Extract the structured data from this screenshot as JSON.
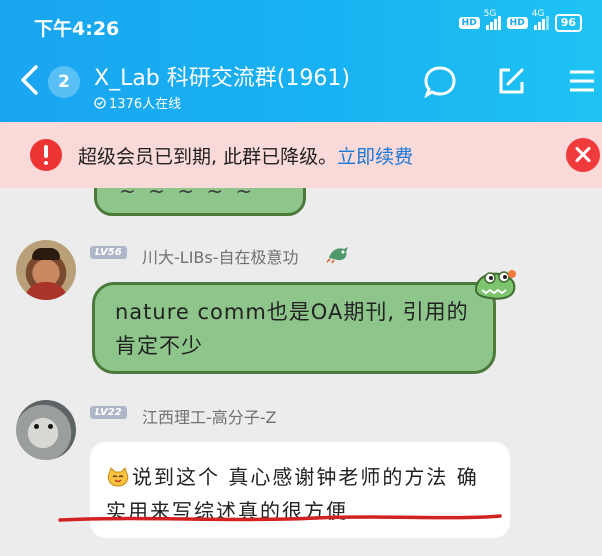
{
  "status_bar": {
    "time": "下午4:26",
    "hd1": "HD",
    "net1": "5G",
    "hd2": "HD",
    "net2": "4G",
    "battery": "96"
  },
  "header": {
    "unread_count": "2",
    "group_name": "X_Lab 科研交流群(1961)",
    "online_count": "1376人在线"
  },
  "banner": {
    "message": "超级会员已到期, 此群已降级。",
    "link": "立即续费"
  },
  "messages": [
    {
      "level": "LV56",
      "sender": "川大-LIBs-自在极意功",
      "text": "nature comm也是OA期刊, 引用的肯定不少"
    },
    {
      "level": "LV22",
      "sender": "江西理工-高分子-Z",
      "text": "说到这个 真心感谢钟老师的方法 确实用来写综述真的很方便"
    }
  ],
  "colors": {
    "header_start": "#1aa5f0",
    "header_end": "#1fc3f3",
    "banner_bg": "#fad9d9",
    "warn": "#ee3333",
    "link": "#1a78d8",
    "bubble_green": "#8ec58a",
    "underline": "#d32020"
  }
}
